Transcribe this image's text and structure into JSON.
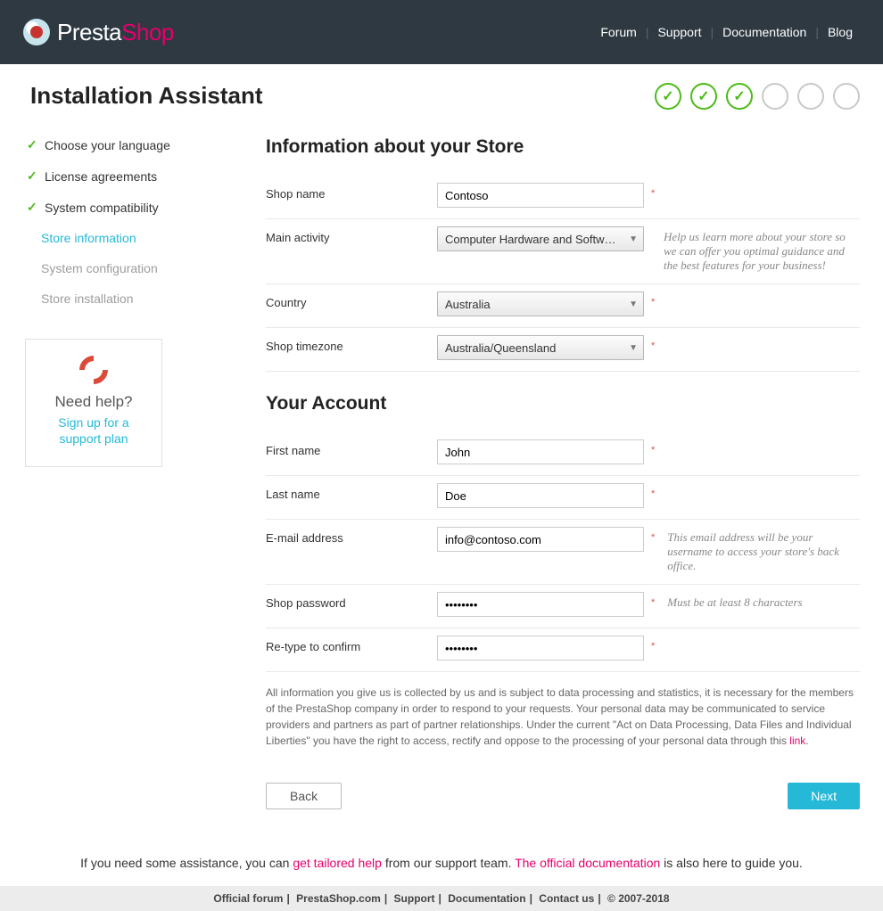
{
  "header": {
    "brand_a": "Presta",
    "brand_b": "Shop",
    "nav": [
      "Forum",
      "Support",
      "Documentation",
      "Blog"
    ]
  },
  "title": "Installation Assistant",
  "progress": {
    "done": 3,
    "total": 6
  },
  "sidebar": {
    "steps": [
      {
        "label": "Choose your language",
        "state": "done"
      },
      {
        "label": "License agreements",
        "state": "done"
      },
      {
        "label": "System compatibility",
        "state": "done"
      },
      {
        "label": "Store information",
        "state": "current"
      },
      {
        "label": "System configuration",
        "state": "todo"
      },
      {
        "label": "Store installation",
        "state": "todo"
      }
    ],
    "help": {
      "title": "Need help?",
      "link": "Sign up for a support plan"
    }
  },
  "form": {
    "section1": "Information about your Store",
    "shop_name": {
      "label": "Shop name",
      "value": "Contoso"
    },
    "activity": {
      "label": "Main activity",
      "value": "Computer Hardware and Softw…",
      "hint": "Help us learn more about your store so we can offer you optimal guidance and the best features for your business!"
    },
    "country": {
      "label": "Country",
      "value": "Australia"
    },
    "timezone": {
      "label": "Shop timezone",
      "value": "Australia/Queensland"
    },
    "section2": "Your Account",
    "first_name": {
      "label": "First name",
      "value": "John"
    },
    "last_name": {
      "label": "Last name",
      "value": "Doe"
    },
    "email": {
      "label": "E-mail address",
      "value": "info@contoso.com",
      "hint": "This email address will be your username to access your store's back office."
    },
    "password": {
      "label": "Shop password",
      "value": "••••••••",
      "hint": "Must be at least 8 characters"
    },
    "password2": {
      "label": "Re-type to confirm",
      "value": "••••••••"
    },
    "disclaimer": "All information you give us is collected by us and is subject to data processing and statistics, it is necessary for the members of the PrestaShop company in order to respond to your requests. Your personal data may be communicated to service providers and partners as part of partner relationships. Under the current \"Act on Data Processing, Data Files and Individual Liberties\" you have the right to access, rectify and oppose to the processing of your personal data through this ",
    "disclaimer_link": "link",
    "back": "Back",
    "next": "Next"
  },
  "assist": {
    "pre": "If you need some assistance, you can ",
    "link1": "get tailored help",
    "mid": " from our support team. ",
    "link2": "The official documentation",
    "post": " is also here to guide you."
  },
  "footer": {
    "items": [
      "Official forum",
      "PrestaShop.com",
      "Support",
      "Documentation",
      "Contact us"
    ],
    "copyright": "© 2007-2018"
  }
}
